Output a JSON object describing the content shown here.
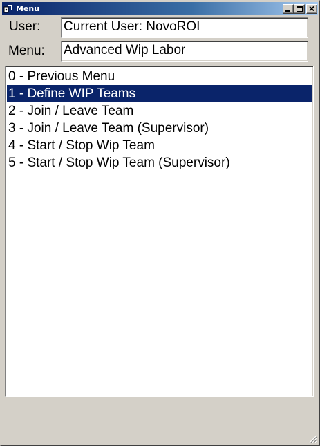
{
  "window": {
    "title": "Menu",
    "accent_color": "#0a246a",
    "controls": [
      "minimize-icon",
      "maximize-icon",
      "close-icon"
    ]
  },
  "fields": {
    "user_label": "User:",
    "user_value": "Current User: NovoROI",
    "menu_label": "Menu:",
    "menu_value": "Advanced Wip Labor"
  },
  "menu_items": [
    {
      "label": "0 - Previous Menu",
      "selected": false
    },
    {
      "label": "1 - Define WIP Teams",
      "selected": true
    },
    {
      "label": "2 - Join / Leave Team",
      "selected": false
    },
    {
      "label": "3 - Join / Leave Team (Supervisor)",
      "selected": false
    },
    {
      "label": "4 - Start / Stop Wip Team",
      "selected": false
    },
    {
      "label": "5 - Start / Stop Wip Team (Supervisor)",
      "selected": false
    }
  ]
}
